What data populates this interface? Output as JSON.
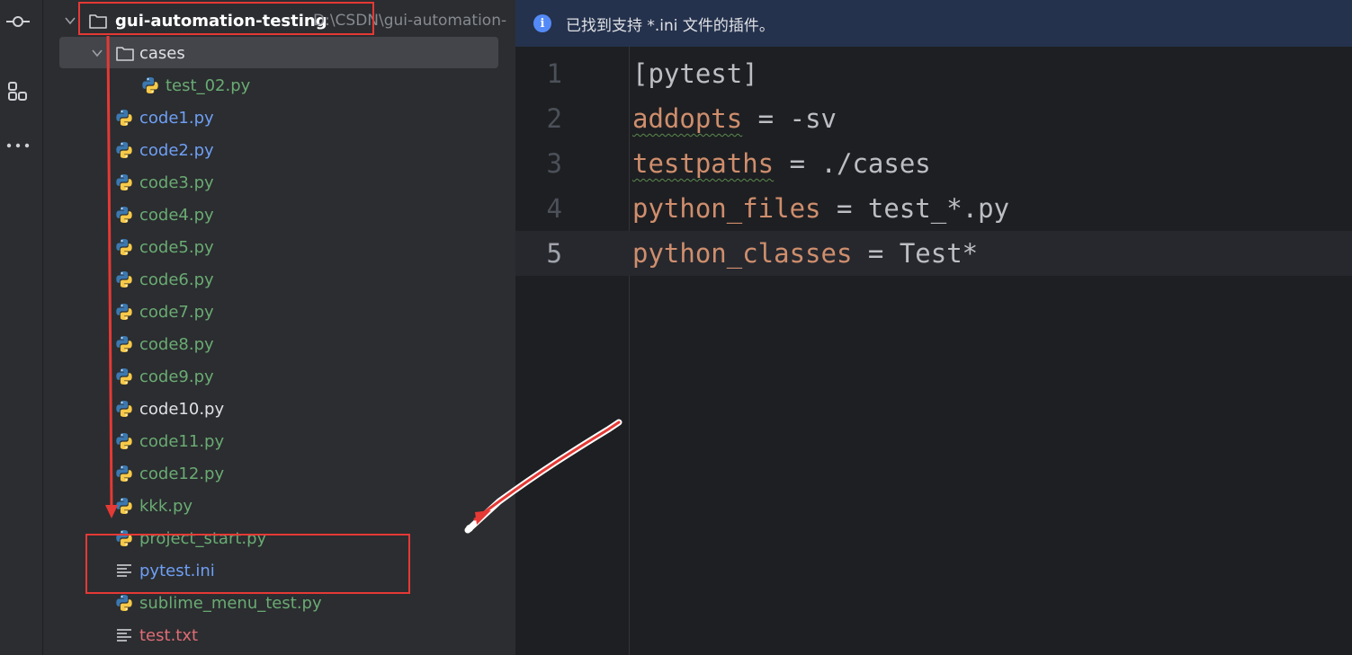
{
  "project": {
    "root_name": "gui-automation-testing",
    "root_path": "D:\\CSDN\\gui-automation-",
    "folder_cases": "cases",
    "files": [
      {
        "name": "test_02.py",
        "color": "green",
        "type": "python"
      },
      {
        "name": "code1.py",
        "color": "blue",
        "type": "python"
      },
      {
        "name": "code2.py",
        "color": "blue",
        "type": "python"
      },
      {
        "name": "code3.py",
        "color": "green",
        "type": "python"
      },
      {
        "name": "code4.py",
        "color": "green",
        "type": "python"
      },
      {
        "name": "code5.py",
        "color": "green",
        "type": "python"
      },
      {
        "name": "code6.py",
        "color": "green",
        "type": "python"
      },
      {
        "name": "code7.py",
        "color": "green",
        "type": "python"
      },
      {
        "name": "code8.py",
        "color": "green",
        "type": "python"
      },
      {
        "name": "code9.py",
        "color": "green",
        "type": "python"
      },
      {
        "name": "code10.py",
        "color": "white",
        "type": "python"
      },
      {
        "name": "code11.py",
        "color": "green",
        "type": "python"
      },
      {
        "name": "code12.py",
        "color": "green",
        "type": "python"
      },
      {
        "name": "kkk.py",
        "color": "green",
        "type": "python"
      },
      {
        "name": "project_start.py",
        "color": "green",
        "type": "python"
      },
      {
        "name": "pytest.ini",
        "color": "blue",
        "type": "text"
      },
      {
        "name": "sublime_menu_test.py",
        "color": "green",
        "type": "python"
      },
      {
        "name": "test.txt",
        "color": "red",
        "type": "text"
      }
    ]
  },
  "editor": {
    "banner_text": "已找到支持 *.ini 文件的插件。",
    "banner_icon": "info-icon",
    "lines": [
      {
        "num": "1",
        "key": "[pytest]",
        "op": "",
        "value": ""
      },
      {
        "num": "2",
        "key": "addopts",
        "op": " = ",
        "value": "-sv"
      },
      {
        "num": "3",
        "key": "testpaths",
        "op": " = ",
        "value": "./cases"
      },
      {
        "num": "4",
        "key": "python_files",
        "op": " = ",
        "value": "test_*.py"
      },
      {
        "num": "5",
        "key": "python_classes",
        "op": " = ",
        "value": "Test*"
      }
    ]
  },
  "colors": {
    "annotation": "#e53935",
    "green": "#6aab73",
    "blue": "#6f9ff5",
    "red": "#e06c75",
    "key": "#cf8e6d"
  },
  "icons": [
    "commit-icon",
    "structure-icon",
    "more-icon",
    "folder-icon",
    "python-file-icon",
    "text-file-icon",
    "chevron-down-icon"
  ]
}
